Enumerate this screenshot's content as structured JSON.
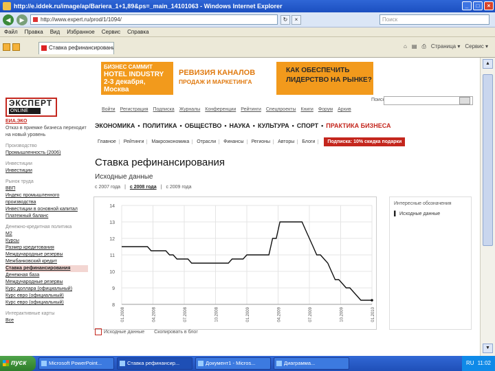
{
  "window": {
    "title": "http://e.iddek.ru/image/ap/Bariera_1+1,89&ps=_main_14101063 - Windows Internet Explorer",
    "address": "http://www.expert.ru/prod/1/1094/",
    "search_placeholder": "Поиск",
    "menu": [
      "Файл",
      "Правка",
      "Вид",
      "Избранное",
      "Сервис",
      "Справка"
    ],
    "tab_label": "Ставка рефинансирования",
    "tool_icons": [
      "⌂",
      "▤",
      "⎙",
      "Страница ▾",
      "Сервис ▾"
    ]
  },
  "banner": {
    "b1_line1": "БИЗНЕС САММИТ",
    "b1_line2": "HOTEL INDUSTRY",
    "b1_line3": "2-3 декабря, Москва",
    "b2_line1": "РЕВИЗИЯ КАНАЛОВ",
    "b2_line2": "ПРОДАЖ И МАРКЕТИНГА",
    "b3_line1": "КАК ОБЕСПЕЧИТЬ",
    "b3_line2": "ЛИДЕРСТВО НА РЫНКЕ?"
  },
  "logo": {
    "name": "ЭКСПЕРТ",
    "sub": "ONLINE"
  },
  "toplinks": [
    "Войти",
    "Регистрация",
    "Подписка",
    "Журналы",
    "Конференции",
    "Рейтинги",
    "Спецпроекты",
    "Книги",
    "Форум",
    "Архив"
  ],
  "site_search_label": "Поиск",
  "mainnav": {
    "items": [
      "ЭКОНОМИКА",
      "ПОЛИТИКА",
      "ОБЩЕСТВО",
      "НАУКА",
      "КУЛЬТУРА",
      "СПОРТ"
    ],
    "highlight": "ПРАКТИКА БИЗНЕСА",
    "sep": "•"
  },
  "subnav": {
    "items": [
      "Главное",
      "Рейтинги",
      "Макроэкономика",
      "Отрасли",
      "Финансы",
      "Регионы",
      "Авторы",
      "Блоги"
    ],
    "promo": "Подписка: 10% скидка подарки"
  },
  "leftcol": {
    "top_link": "ЕИА.ЭКО",
    "top_text": "Отказ в приемке бизнеса переходит на новый уровень",
    "sections": [
      {
        "heading": "Производство",
        "lines": [
          "Промышленность (2006)"
        ]
      },
      {
        "heading": "Инвестиции",
        "lines": [
          "Инвестиции"
        ]
      },
      {
        "heading": "Рынок труда",
        "lines": [
          "ВВП",
          "Индекс промышленного производства",
          "Инвестиции в основной капитал",
          "Платежный баланс"
        ]
      },
      {
        "heading": "Денежно-кредитная политика",
        "lines": [
          "М2",
          "Курсы",
          "Размер кредитования",
          "Международные резервы",
          "Межбанковский кредит",
          "Ставка рефинансирования",
          "Денежная база",
          "Международные резервы",
          "Курс доллара (официальный)",
          "Курс евро (официальный)",
          "Курс евро (официальный)"
        ]
      },
      {
        "heading": "Интерактивные карты",
        "lines": [
          "Все"
        ]
      }
    ],
    "active_label": "Ставка рефинансирования"
  },
  "page": {
    "title": "Ставка рефинансирования",
    "subtitle": "Исходные данные",
    "periods": [
      "с 2007 года",
      "с 2008 года",
      "с 2009 года"
    ],
    "active_period": "с 2008 года"
  },
  "sidepanel": {
    "heading": "Интересные обозначения",
    "item": "Исходные данные"
  },
  "chart_legend": {
    "item1": "Исходные данные",
    "item2": "Скопировать в блог"
  },
  "chart_data": {
    "type": "line",
    "title": "",
    "xlabel": "",
    "ylabel": "",
    "ylim": [
      8,
      14
    ],
    "yticks": [
      14,
      13,
      12,
      11,
      10,
      9,
      8
    ],
    "x_ticks": [
      "01.2008",
      "04.2008",
      "07.2008",
      "10.2008",
      "01.2009",
      "04.2009",
      "07.2009",
      "10.2009",
      "01.2010"
    ],
    "values": [
      11.5,
      11.5,
      11.5,
      11.5,
      11.5,
      11.5,
      11.5,
      11.5,
      11.25,
      11.25,
      11.25,
      11.25,
      11.25,
      11.0,
      11.0,
      10.75,
      10.75,
      10.75,
      10.75,
      10.5,
      10.5,
      10.5,
      10.5,
      10.5,
      10.5,
      10.5,
      10.5,
      10.5,
      10.5,
      10.5,
      10.75,
      10.75,
      10.75,
      10.75,
      11.0,
      11.0,
      11.0,
      11.0,
      11.0,
      11.0,
      11.0,
      12.0,
      12.0,
      13.0,
      13.0,
      13.0,
      13.0,
      13.0,
      13.0,
      13.0,
      12.5,
      12.0,
      11.5,
      11.0,
      11.0,
      10.75,
      10.5,
      10.0,
      9.5,
      9.5,
      9.25,
      9.0,
      9.0,
      8.75,
      8.5,
      8.25,
      8.25,
      8.25,
      8.25
    ],
    "colors": {
      "line": "#111111",
      "grid": "#e4e4e4"
    }
  },
  "taskbar": {
    "start": "пуск",
    "tasks": [
      "Microsoft PowerPoint...",
      "Ставка рефинансир...",
      "Документ1 - Micros...",
      "Диаграмма..."
    ],
    "tray_lang": "RU",
    "tray_time": "11:02"
  }
}
